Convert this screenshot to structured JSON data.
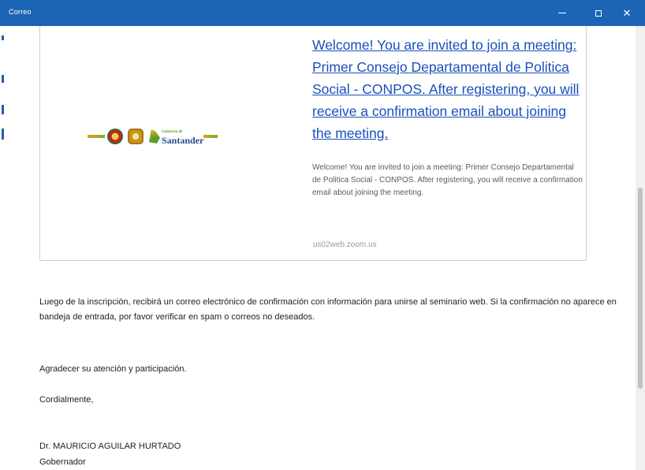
{
  "window": {
    "title": "Correo",
    "minimize_glyph": "—",
    "maximize_glyph": "☐",
    "close_glyph": "✕"
  },
  "card": {
    "logo_brand": "Santander",
    "logo_brand_small": "Gobierno de",
    "link_title": "Welcome! You are invited to join a meeting: Primer Consejo Departamental de Politica Social - CONPOS. After registering, you will receive a confirmation email about joining the meeting.",
    "description": "Welcome! You are invited to join a meeting: Primer Consejo Departamental de Politica Social - CONPOS. After registering, you will receive a confirmation email about joining the meeting.",
    "domain": "us02web.zoom.us"
  },
  "body": {
    "paragraph1": "Luego de la inscripción, recibirá un correo electrónico de confirmación con información para unirse al seminario web. Si la confirmación no aparece en bandeja de entrada, por favor verificar en spam o correos no deseados.",
    "paragraph2": "Agradecer su atención y participación.",
    "closing": "Cordialmente,",
    "signature_name": "Dr. MAURICIO AGUILAR HURTADO",
    "signature_title": "Gobernador"
  },
  "colors": {
    "titlebar": "#1c64b5",
    "link": "#1a4fbb"
  }
}
